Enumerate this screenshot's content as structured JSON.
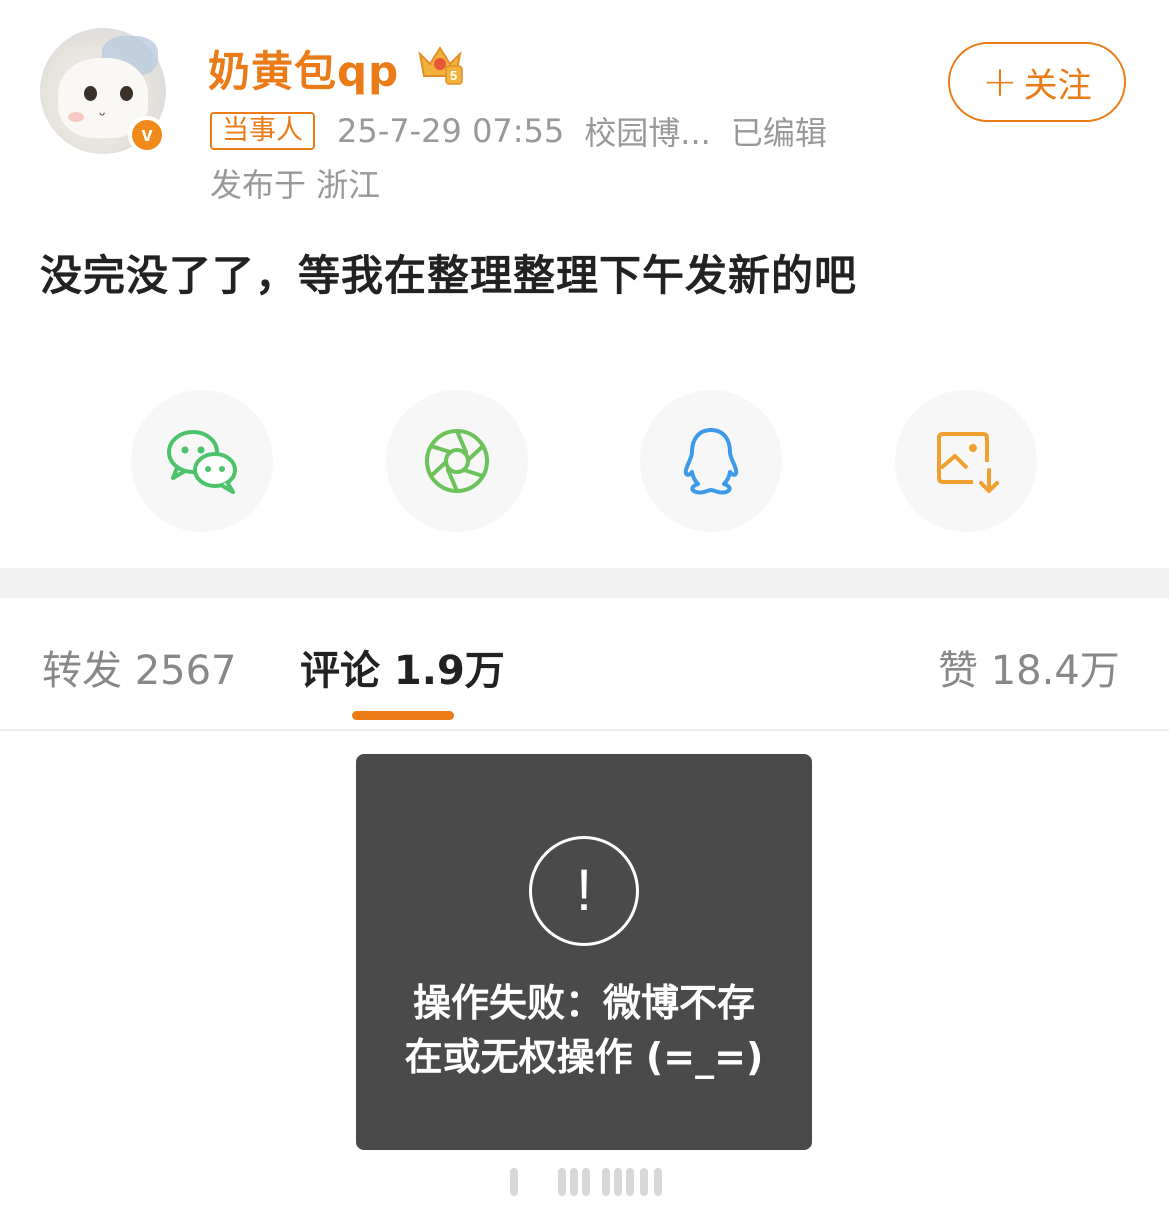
{
  "post": {
    "username": "奶黄包qp",
    "tag": "当事人",
    "time": "25-7-29 07:55",
    "source": "校园博...",
    "edited": "已编辑",
    "location": "发布于 浙江",
    "text": "没完没了了，等我在整理整理下午发新的吧"
  },
  "follow": {
    "plus": "+",
    "label": "关注"
  },
  "share": {
    "icons": [
      "wechat-icon",
      "moments-icon",
      "qq-icon",
      "save-image-icon"
    ]
  },
  "tabs": {
    "repost": "转发 2567",
    "comment": "评论 1.9万",
    "like": "赞 18.4万"
  },
  "toast": {
    "icon": "!",
    "message_line1": "操作失败：微博不存",
    "message_line2": "在或无权操作 (=_=)"
  },
  "colors": {
    "accent": "#eb7b16",
    "toast_bg": "#4a4a4a",
    "wechat_green": "#4cc36b",
    "qq_blue": "#3d9ae8",
    "save_orange": "#f0a030"
  }
}
